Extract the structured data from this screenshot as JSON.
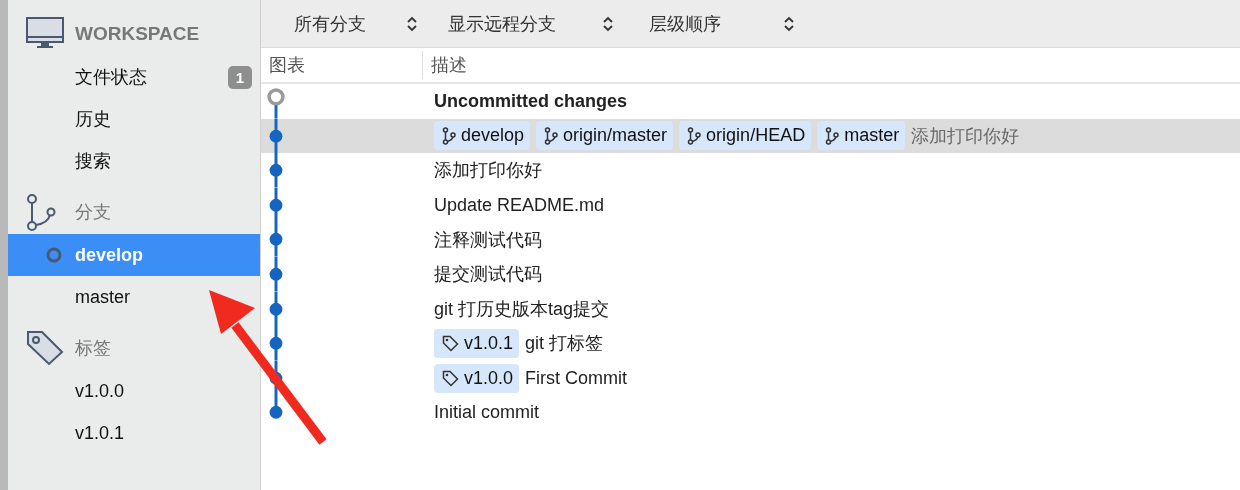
{
  "sidebar": {
    "sections": [
      {
        "kind": "workspace",
        "title": "WORKSPACE",
        "items": [
          {
            "label": "文件状态",
            "badge": "1",
            "selected": false
          },
          {
            "label": "历史",
            "selected": false
          },
          {
            "label": "搜索",
            "selected": false
          }
        ]
      },
      {
        "kind": "branches",
        "title": "分支",
        "items": [
          {
            "label": "develop",
            "selected": true,
            "current": true
          },
          {
            "label": "master",
            "selected": false,
            "current": false
          }
        ]
      },
      {
        "kind": "tags",
        "title": "标签",
        "items": [
          {
            "label": "v1.0.0",
            "selected": false
          },
          {
            "label": "v1.0.1",
            "selected": false
          }
        ]
      }
    ]
  },
  "toolbar": {
    "dropdowns": [
      {
        "label": "所有分支"
      },
      {
        "label": "显示远程分支"
      },
      {
        "label": "层级顺序"
      }
    ]
  },
  "table": {
    "columns": [
      "图表",
      "描述"
    ],
    "rows": [
      {
        "kind": "uncommitted",
        "description": "Uncommitted changes",
        "selected": false,
        "refs": []
      },
      {
        "kind": "commit",
        "description": "添加打印你好",
        "selected": true,
        "refs": [
          {
            "kind": "branch",
            "label": "develop"
          },
          {
            "kind": "branch",
            "label": "origin/master"
          },
          {
            "kind": "branch",
            "label": "origin/HEAD"
          },
          {
            "kind": "branch",
            "label": "master"
          }
        ]
      },
      {
        "kind": "commit",
        "description": "添加打印你好",
        "selected": false,
        "refs": []
      },
      {
        "kind": "commit",
        "description": "Update README.md",
        "selected": false,
        "refs": []
      },
      {
        "kind": "commit",
        "description": "注释测试代码",
        "selected": false,
        "refs": []
      },
      {
        "kind": "commit",
        "description": "提交测试代码",
        "selected": false,
        "refs": []
      },
      {
        "kind": "commit",
        "description": "git 打历史版本tag提交",
        "selected": false,
        "refs": []
      },
      {
        "kind": "commit",
        "description": "git 打标签",
        "selected": false,
        "refs": [
          {
            "kind": "tag",
            "label": "v1.0.1"
          }
        ]
      },
      {
        "kind": "commit",
        "description": "First Commit",
        "selected": false,
        "refs": [
          {
            "kind": "tag",
            "label": "v1.0.0"
          }
        ]
      },
      {
        "kind": "commit",
        "description": "Initial commit",
        "selected": false,
        "refs": []
      }
    ]
  }
}
